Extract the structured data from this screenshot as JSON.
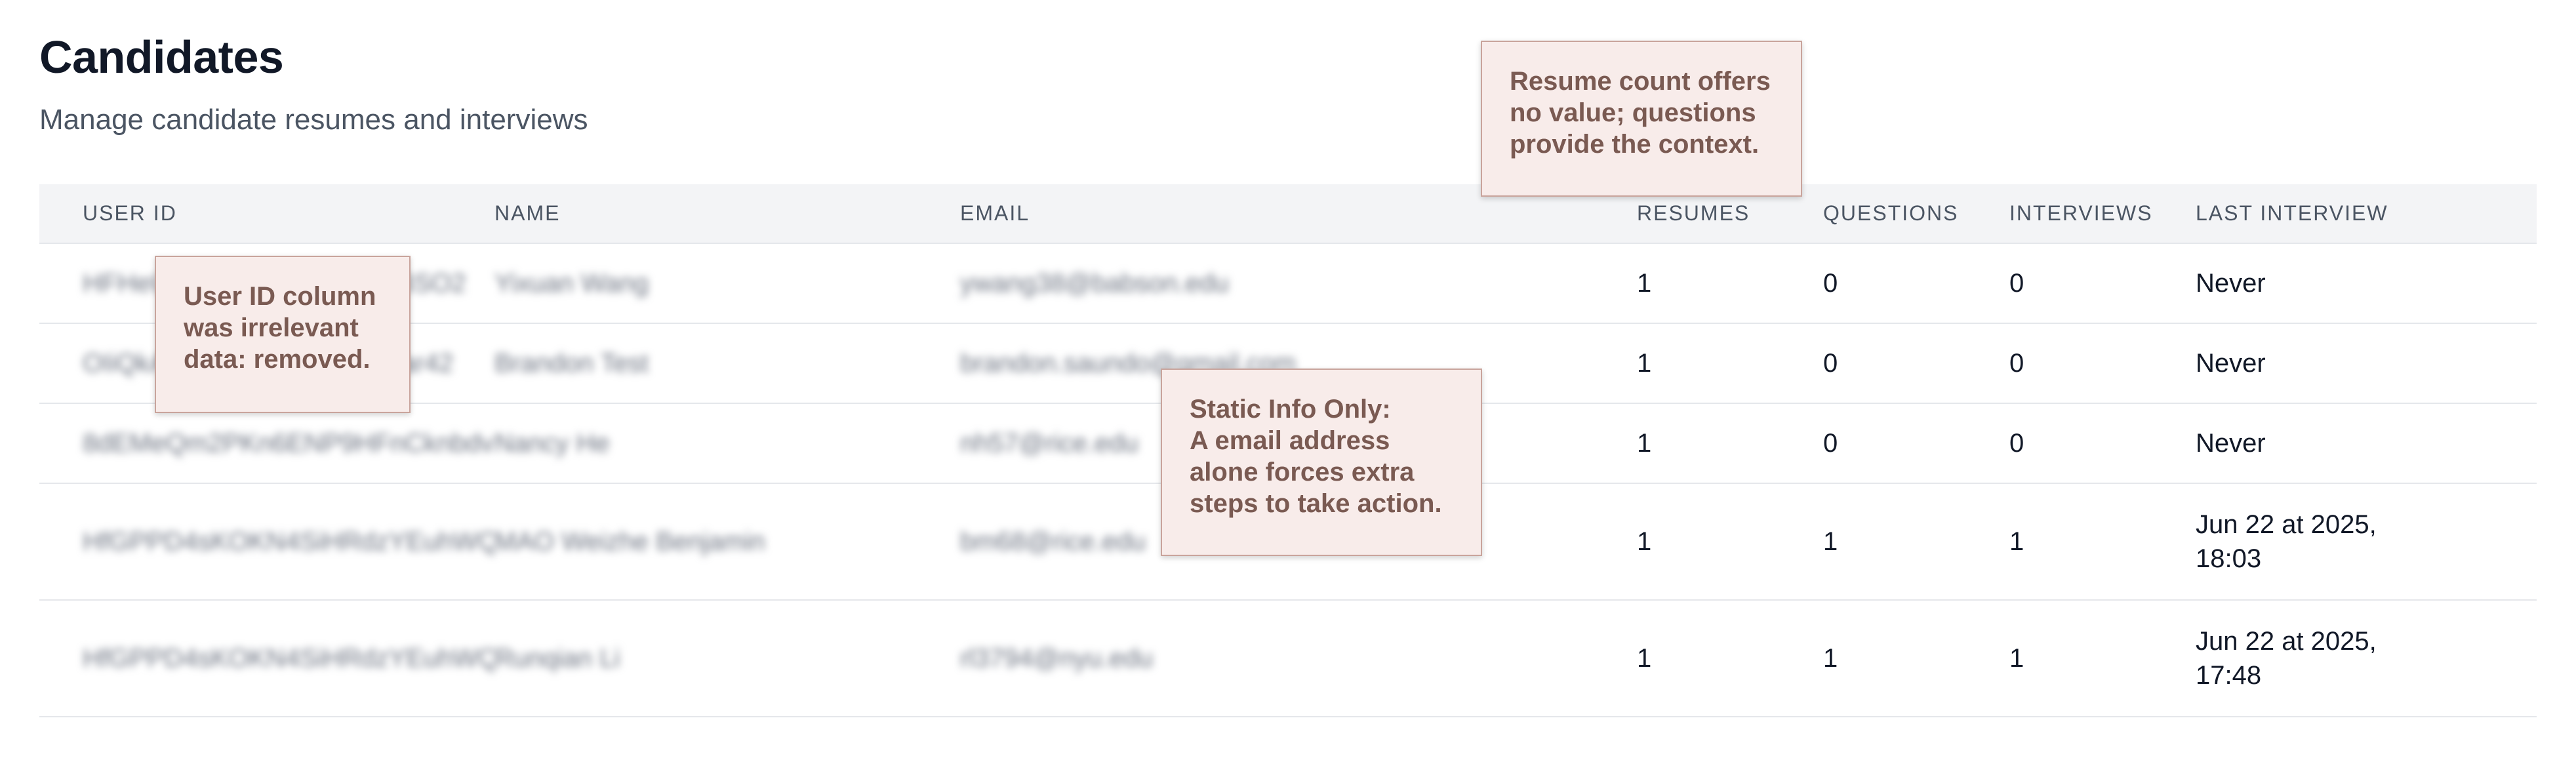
{
  "page": {
    "title": "Candidates",
    "subtitle": "Manage candidate resumes and interviews"
  },
  "table": {
    "headers": {
      "user_id": "USER ID",
      "name": "NAME",
      "email": "EMAIL",
      "resumes": "RESUMES",
      "questions": "QUESTIONS",
      "interviews": "INTERVIEWS",
      "last_interview": "LAST INTERVIEW"
    },
    "rows": [
      {
        "user_id": "HFHeUqPPD4sKOKN4SiKBSO2",
        "name": "Yixuan Wang",
        "email": "ywang38@babson.edu",
        "resumes": "1",
        "questions": "0",
        "interviews": "0",
        "last_interview_line1": "Never",
        "last_interview_line2": ""
      },
      {
        "user_id": "OIiQkAqPD4sKOKN4SiHWar42",
        "name": "Brandon Test",
        "email": "brandon.saundo@gmail.com",
        "resumes": "1",
        "questions": "0",
        "interviews": "0",
        "last_interview_line1": "Never",
        "last_interview_line2": ""
      },
      {
        "user_id": "8dEMeQm2PKn6ENP9HFnCknbdv2",
        "name": "Nancy He",
        "email": "nh57@rice.edu",
        "resumes": "1",
        "questions": "0",
        "interviews": "0",
        "last_interview_line1": "Never",
        "last_interview_line2": ""
      },
      {
        "user_id": "HfGPPD4sKOKN4SiHRdzYEuhWQc2",
        "name": "MAO Weizhe Benjamin",
        "email": "bm68@rice.edu",
        "resumes": "1",
        "questions": "1",
        "interviews": "1",
        "last_interview_line1": "Jun 22 at 2025,",
        "last_interview_line2": "18:03"
      },
      {
        "user_id": "HfGPPD4sKOKN4SiHRdzYEuhWQc2",
        "name": "Runqian Li",
        "email": "rl3794@nyu.edu",
        "resumes": "1",
        "questions": "1",
        "interviews": "1",
        "last_interview_line1": "Jun 22 at 2025,",
        "last_interview_line2": "17:48"
      }
    ]
  },
  "annotations": {
    "resume_note": "Resume count offers no value; questions provide the context.",
    "userid_note": "User ID column was irrelevant data: removed.",
    "email_note_title": "Static Info Only:",
    "email_note_body": "A email address alone forces extra steps to take action."
  }
}
